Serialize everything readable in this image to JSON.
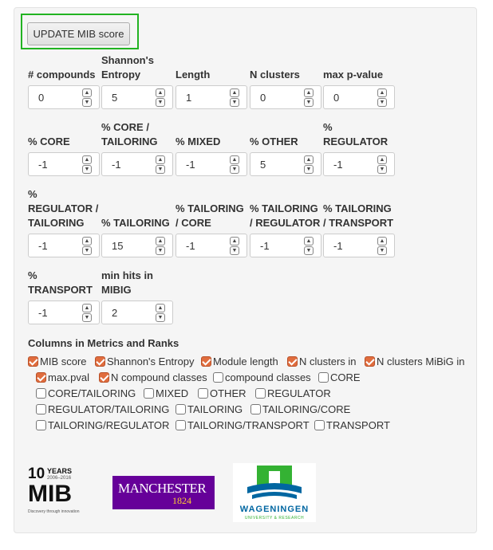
{
  "update_button": "UPDATE MIB score",
  "fields": [
    {
      "label": "# compounds",
      "value": "0"
    },
    {
      "label": "Shannon's Entropy",
      "value": "5"
    },
    {
      "label": "Length",
      "value": "1"
    },
    {
      "label": "N clusters",
      "value": "0"
    },
    {
      "label": "max p-value",
      "value": "0"
    },
    {
      "label": "% CORE",
      "value": "-1"
    },
    {
      "label": "% CORE / TAILORING",
      "value": "-1"
    },
    {
      "label": "% MIXED",
      "value": "-1"
    },
    {
      "label": "% OTHER",
      "value": "5"
    },
    {
      "label": "% REGULATOR",
      "value": "-1"
    },
    {
      "label": "% REGULATOR / TAILORING",
      "value": "-1"
    },
    {
      "label": "% TAILORING",
      "value": "15"
    },
    {
      "label": "% TAILORING / CORE",
      "value": "-1"
    },
    {
      "label": "% TAILORING / REGULATOR",
      "value": "-1"
    },
    {
      "label": "% TAILORING / TRANSPORT",
      "value": "-1"
    },
    {
      "label": "% TRANSPORT",
      "value": "-1"
    },
    {
      "label": "min hits in MIBIG",
      "value": "2"
    }
  ],
  "columns_title": "Columns in Metrics and Ranks",
  "columns": [
    {
      "label": "MIB score",
      "checked": true
    },
    {
      "label": "Shannon's Entropy",
      "checked": true
    },
    {
      "label": "Module length",
      "checked": true
    },
    {
      "label": "N clusters in",
      "checked": true
    },
    {
      "label": "N clusters MiBiG in",
      "checked": true
    },
    {
      "label": "max.pval",
      "checked": true
    },
    {
      "label": "N compound classes",
      "checked": true
    },
    {
      "label": "compound classes",
      "checked": false
    },
    {
      "label": "CORE",
      "checked": false
    },
    {
      "label": "CORE/TAILORING",
      "checked": false
    },
    {
      "label": "MIXED",
      "checked": false
    },
    {
      "label": "OTHER",
      "checked": false
    },
    {
      "label": "REGULATOR",
      "checked": false
    },
    {
      "label": "REGULATOR/TAILORING",
      "checked": false
    },
    {
      "label": "TAILORING",
      "checked": false
    },
    {
      "label": "TAILORING/CORE",
      "checked": false
    },
    {
      "label": "TAILORING/REGULATOR",
      "checked": false
    },
    {
      "label": "TAILORING/TRANSPORT",
      "checked": false
    },
    {
      "label": "TRANSPORT",
      "checked": false
    }
  ],
  "logos": {
    "mib": {
      "years": "10",
      "years_word": "YEARS",
      "range": "2006–2016",
      "name": "MIB",
      "tagline": "Discovery through innovation"
    },
    "manchester": {
      "name": "MANCHESTER",
      "year": "1824",
      "bg": "#660099",
      "accent": "#ffcc33"
    },
    "wageningen": {
      "name": "WAGENINGEN",
      "sub": "UNIVERSITY & RESEARCH",
      "green": "#34b233",
      "blue": "#0066a1"
    }
  }
}
